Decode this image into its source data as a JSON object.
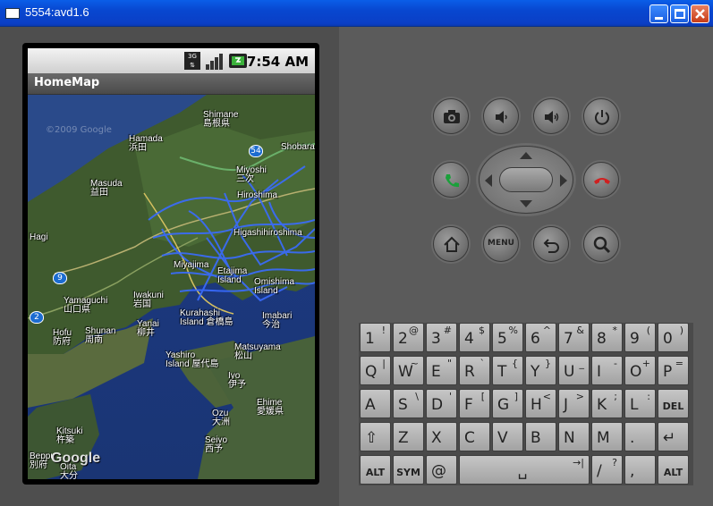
{
  "window": {
    "title": "5554:avd1.6"
  },
  "status": {
    "network": "3G",
    "time": "7:54 AM"
  },
  "app": {
    "title": "HomeMap"
  },
  "map": {
    "labels": [
      {
        "text": "Shimane",
        "sub": "島根県"
      },
      {
        "text": "Hamada",
        "sub": "浜田"
      },
      {
        "text": "Shobara",
        "sub": ""
      },
      {
        "text": "Miyoshi",
        "sub": "三次"
      },
      {
        "text": "Masuda",
        "sub": "益田"
      },
      {
        "text": "Hiroshima",
        "sub": ""
      },
      {
        "text": "Higashihiroshima",
        "sub": ""
      },
      {
        "text": "Hagi",
        "sub": ""
      },
      {
        "text": "Miyajima",
        "sub": ""
      },
      {
        "text": "Etajima",
        "sub": "Island"
      },
      {
        "text": "Omishima",
        "sub": "Island"
      },
      {
        "text": "Yamaguchi",
        "sub": "山口県"
      },
      {
        "text": "Iwakuni",
        "sub": "岩国"
      },
      {
        "text": "Kurahashi",
        "sub": "Island 倉橋島"
      },
      {
        "text": "Imabari",
        "sub": "今治"
      },
      {
        "text": "Hofu",
        "sub": "防府"
      },
      {
        "text": "Shunan",
        "sub": "周南"
      },
      {
        "text": "Yanai",
        "sub": "柳井"
      },
      {
        "text": "Yashiro",
        "sub": "Island 屋代島"
      },
      {
        "text": "Matsuyama",
        "sub": "松山"
      },
      {
        "text": "Iyo",
        "sub": "伊予"
      },
      {
        "text": "Ehime",
        "sub": "愛媛県"
      },
      {
        "text": "Kitsuki",
        "sub": "杵築"
      },
      {
        "text": "Ozu",
        "sub": "大洲"
      },
      {
        "text": "Seiyo",
        "sub": "西予"
      },
      {
        "text": "Beppu",
        "sub": "別府"
      },
      {
        "text": "Oita",
        "sub": "大分"
      }
    ],
    "shields": [
      "54",
      "9",
      "2"
    ],
    "watermark_top": "©2009 Google",
    "logo": "Google"
  },
  "controls": {
    "menu_label": "MENU"
  },
  "keyboard": {
    "rows": [
      [
        {
          "m": "1",
          "a": "!"
        },
        {
          "m": "2",
          "a": "@"
        },
        {
          "m": "3",
          "a": "#"
        },
        {
          "m": "4",
          "a": "$"
        },
        {
          "m": "5",
          "a": "%"
        },
        {
          "m": "6",
          "a": "^"
        },
        {
          "m": "7",
          "a": "&"
        },
        {
          "m": "8",
          "a": "*"
        },
        {
          "m": "9",
          "a": "("
        },
        {
          "m": "0",
          "a": ")"
        }
      ],
      [
        {
          "m": "Q",
          "a": "|"
        },
        {
          "m": "W",
          "a": "~"
        },
        {
          "m": "E",
          "a": "\""
        },
        {
          "m": "R",
          "a": "`"
        },
        {
          "m": "T",
          "a": "{"
        },
        {
          "m": "Y",
          "a": "}"
        },
        {
          "m": "U",
          "a": "_"
        },
        {
          "m": "I",
          "a": "-"
        },
        {
          "m": "O",
          "a": "+"
        },
        {
          "m": "P",
          "a": "="
        }
      ],
      [
        {
          "m": "A",
          "a": ""
        },
        {
          "m": "S",
          "a": "\\"
        },
        {
          "m": "D",
          "a": "'"
        },
        {
          "m": "F",
          "a": "["
        },
        {
          "m": "G",
          "a": "]"
        },
        {
          "m": "H",
          "a": "<"
        },
        {
          "m": "J",
          "a": ">"
        },
        {
          "m": "K",
          "a": ";"
        },
        {
          "m": "L",
          "a": ":"
        },
        {
          "m": "DEL",
          "a": ""
        }
      ],
      [
        {
          "m": "⇧",
          "a": ""
        },
        {
          "m": "Z",
          "a": ""
        },
        {
          "m": "X",
          "a": ""
        },
        {
          "m": "C",
          "a": ""
        },
        {
          "m": "V",
          "a": ""
        },
        {
          "m": "B",
          "a": ""
        },
        {
          "m": "N",
          "a": ""
        },
        {
          "m": "M",
          "a": ""
        },
        {
          "m": ".",
          "a": ""
        },
        {
          "m": "↵",
          "a": ""
        }
      ],
      [
        {
          "m": "ALT",
          "a": ""
        },
        {
          "m": "SYM",
          "a": ""
        },
        {
          "m": "@",
          "a": ""
        },
        {
          "m": "␣",
          "a": "→|"
        },
        {
          "m": "/",
          "a": "?"
        },
        {
          "m": ",",
          "a": ""
        },
        {
          "m": "ALT",
          "a": ""
        }
      ]
    ]
  }
}
